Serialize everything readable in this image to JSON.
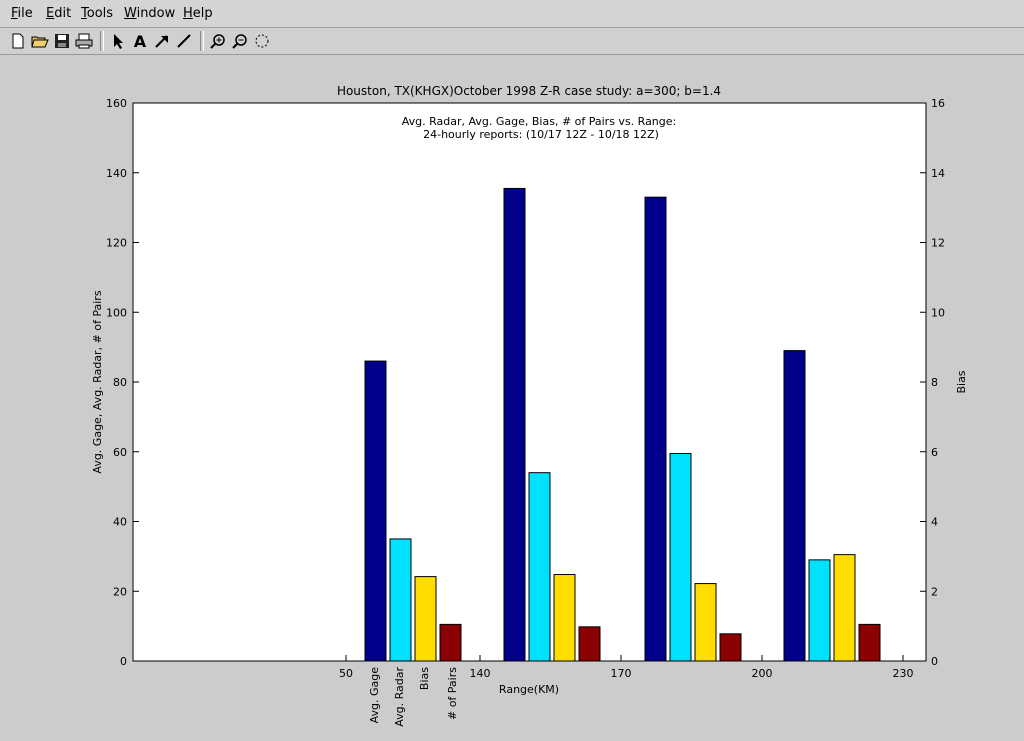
{
  "menu": [
    {
      "label": "File",
      "underline": "F",
      "rest": "ile"
    },
    {
      "label": "Edit",
      "underline": "E",
      "rest": "dit"
    },
    {
      "label": "Tools",
      "underline": "T",
      "rest": "ools"
    },
    {
      "label": "Window",
      "underline": "W",
      "rest": "indow"
    },
    {
      "label": "Help",
      "underline": "H",
      "rest": "elp"
    }
  ],
  "toolbar": [
    "new-file-icon",
    "open-folder-icon",
    "save-icon",
    "print-icon",
    "select-arrow-icon",
    "text-tool-icon",
    "arrow-tool-icon",
    "line-tool-icon",
    "zoom-in-icon",
    "zoom-out-icon",
    "rotate-icon"
  ],
  "chart_data": {
    "type": "bar",
    "title": "Houston, TX(KHGX)October 1998 Z-R case study: a=300; b=1.4",
    "subtitle_line1": "Avg. Radar, Avg. Gage, Bias, # of Pairs vs. Range:",
    "subtitle_line2": "24-hourly reports: (10/17 12Z - 10/18 12Z)",
    "xlabel": "Range(KM)",
    "ylabel_left": "Avg. Gage, Avg. Radar, # of Pairs",
    "ylabel_right": "Bias",
    "ylim_left": [
      0,
      160
    ],
    "ylim_right": [
      0,
      16
    ],
    "yticks_left": [
      "0",
      "20",
      "40",
      "60",
      "80",
      "100",
      "120",
      "140",
      "160"
    ],
    "yticks_right": [
      "0",
      "2",
      "4",
      "6",
      "8",
      "10",
      "12",
      "14",
      "16"
    ],
    "xtick_labels": [
      "50",
      "140",
      "170",
      "200",
      "230"
    ],
    "legend_labels": [
      "Avg. Gage",
      "Avg. Radar",
      "Bias",
      "# of Pairs"
    ],
    "series": [
      {
        "name": "Avg. Gage",
        "color": "#00008b",
        "values": [
          86,
          135.5,
          133,
          89
        ]
      },
      {
        "name": "Avg. Radar",
        "color": "#00e0ff",
        "values": [
          35,
          54,
          59.5,
          29
        ]
      },
      {
        "name": "Bias",
        "color": "#ffdd00",
        "axis": "right",
        "values": [
          2.42,
          2.48,
          2.22,
          3.05
        ]
      },
      {
        "name": "# of Pairs",
        "color": "#8b0000",
        "values": [
          10.5,
          9.8,
          7.8,
          10.5
        ]
      }
    ]
  }
}
